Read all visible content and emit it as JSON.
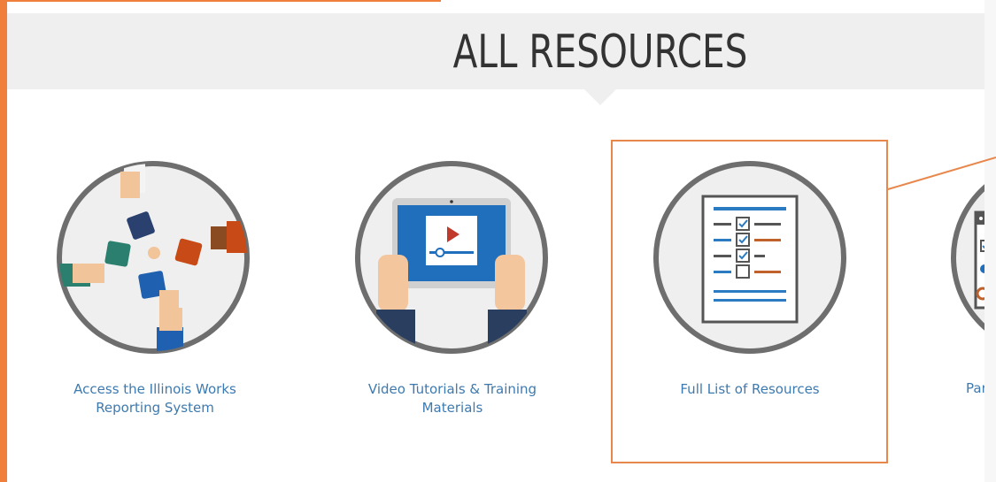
{
  "header": {
    "title": "ALL RESOURCES"
  },
  "cards": [
    {
      "label_line1": "Access the Illinois Works",
      "label_line2": "Reporting System",
      "icon": "puzzle-hands-icon"
    },
    {
      "label_line1": "Video Tutorials & Training",
      "label_line2": "Materials",
      "icon": "video-tablet-icon"
    },
    {
      "label_line1": "Full List of Resources",
      "label_line2": "",
      "icon": "checklist-document-icon"
    },
    {
      "label_line1": "Part",
      "label_line2": "",
      "icon": "browser-checklist-icon"
    }
  ],
  "colors": {
    "accent_orange": "#f07f3c",
    "link_blue": "#3d7ab0",
    "circle_border": "#6e6e6e",
    "circle_fill": "#efefef",
    "highlight_border": "#e8874b"
  }
}
